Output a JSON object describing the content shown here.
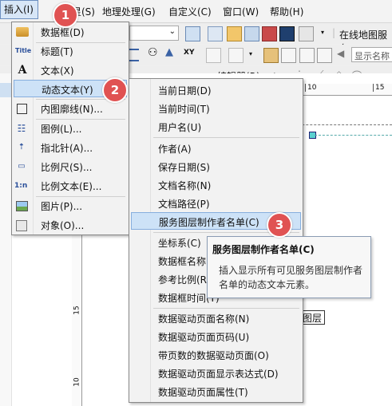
{
  "menubar": {
    "insert": "插入(I)",
    "item_s_fragment": "星(S)",
    "geoprocessing": "地理处理(G)",
    "customize": "自定义(C)",
    "window": "窗口(W)",
    "help": "帮助(H)"
  },
  "toolbar": {
    "online_map_service": "在线地图服务",
    "show_name_placeholder": "显示名称",
    "editor": "编辑器(R)▾",
    "ruler_10": "10",
    "ruler_15": "15",
    "vertical_ruler_15": "15",
    "vertical_ruler_10": "10"
  },
  "insert_menu": {
    "items": [
      {
        "label": "数据框(D)",
        "icon": "data-frame-icon"
      },
      {
        "label": "标题(T)",
        "icon": "title-icon"
      },
      {
        "label": "文本(X)",
        "icon": "text-icon"
      },
      {
        "label": "动态文本(Y)",
        "icon": "dynamic-text-icon"
      },
      {
        "label": "内图廓线(N)...",
        "icon": "neatline-icon"
      },
      {
        "label": "图例(L)...",
        "icon": "legend-icon"
      },
      {
        "label": "指北针(A)...",
        "icon": "north-arrow-icon"
      },
      {
        "label": "比例尺(S)...",
        "icon": "scale-bar-icon"
      },
      {
        "label": "比例文本(E)...",
        "icon": "scale-text-icon"
      },
      {
        "label": "图片(P)...",
        "icon": "picture-icon"
      },
      {
        "label": "对象(O)...",
        "icon": "object-icon"
      }
    ],
    "title_icon_text": "Title",
    "scale_text_icon_text": "1:n"
  },
  "dynamic_text_menu": {
    "items": [
      "当前日期(D)",
      "当前时间(T)",
      "用户名(U)",
      "作者(A)",
      "保存日期(S)",
      "文档名称(N)",
      "文档路径(P)",
      "服务图层制作者名单(C)",
      "坐标系(C)",
      "数据框名称",
      "参考比例(R)",
      "数据框时间(T)",
      "数据驱动页面名称(N)",
      "数据驱动页面页码(U)",
      "带页数的数据驱动页面(O)",
      "数据驱动页面显示表达式(D)",
      "数据驱动页面属性(T)"
    ]
  },
  "tooltip": {
    "title": "服务图层制作者名单(C)",
    "body_line1": "插入显示所有可见服务图层制作者",
    "body_line2": "名单的动态文本元素。"
  },
  "canvas_label": "图层",
  "badges": [
    "1",
    "2",
    "3"
  ],
  "colors": {
    "highlight": "#cde2f7",
    "badge": "#e05252",
    "tooltip_border": "#8a9bb3"
  }
}
